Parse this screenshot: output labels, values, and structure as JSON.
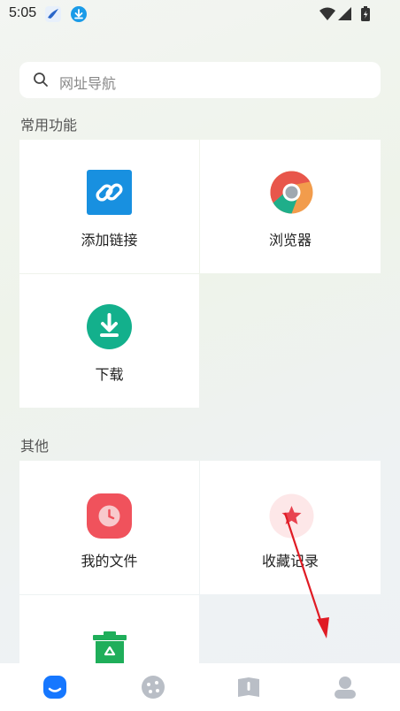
{
  "status_bar": {
    "time": "5:05",
    "icons": [
      "bird-app-icon",
      "download-notification-icon",
      "wifi-icon",
      "signal-icon",
      "battery-icon"
    ]
  },
  "search": {
    "placeholder": "网址导航"
  },
  "sections": [
    {
      "title": "常用功能",
      "items": [
        {
          "label": "添加链接",
          "icon": "link-icon"
        },
        {
          "label": "浏览器",
          "icon": "browser-icon"
        },
        {
          "label": "下载",
          "icon": "download-icon"
        }
      ]
    },
    {
      "title": "其他",
      "items": [
        {
          "label": "我的文件",
          "icon": "clock-icon"
        },
        {
          "label": "收藏记录",
          "icon": "star-icon"
        },
        {
          "label": "",
          "icon": "recycle-bin-icon"
        }
      ]
    }
  ],
  "bottom_nav": {
    "items": [
      {
        "icon": "home-icon",
        "active": true
      },
      {
        "icon": "discover-icon",
        "active": false
      },
      {
        "icon": "book-icon",
        "active": false
      },
      {
        "icon": "profile-icon",
        "active": false
      }
    ]
  },
  "colors": {
    "accent": "#1677ff",
    "link_blue": "#1890e0",
    "download_green": "#13b08c",
    "files_red": "#f0525c",
    "star_red": "#e8424f",
    "recycle_green": "#1fae5a"
  }
}
